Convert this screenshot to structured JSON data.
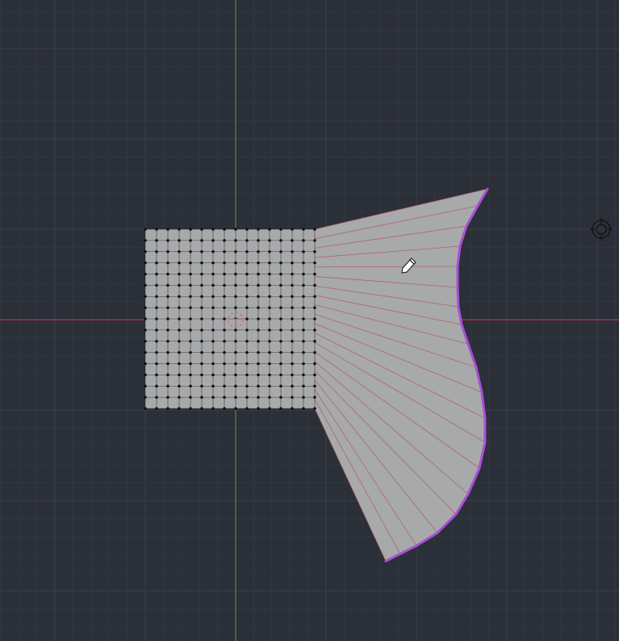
{
  "app": {
    "view": "3d-viewport-top-orthographic",
    "mode": "edit-mode"
  },
  "colors": {
    "background": "#2b2f38",
    "grid_minor": "#323741",
    "grid_major": "#3a3f4a",
    "axis_x": "#b0384a",
    "axis_y": "#5f8a2e",
    "mesh_face": "#a7a9ab",
    "mesh_vertex": "#111111",
    "radial_edge": "#b05a5a",
    "selected_edge": "#a94fd6",
    "origin_marker": "#d07070",
    "gizmo": "#111111"
  },
  "icons": {
    "cursor": "pencil-cursor-icon",
    "gizmo": "view-gizmo-icon",
    "origin": "object-origin-icon"
  },
  "mesh": {
    "grid_columns": 16,
    "grid_rows": 17,
    "fan_segments": 20
  }
}
